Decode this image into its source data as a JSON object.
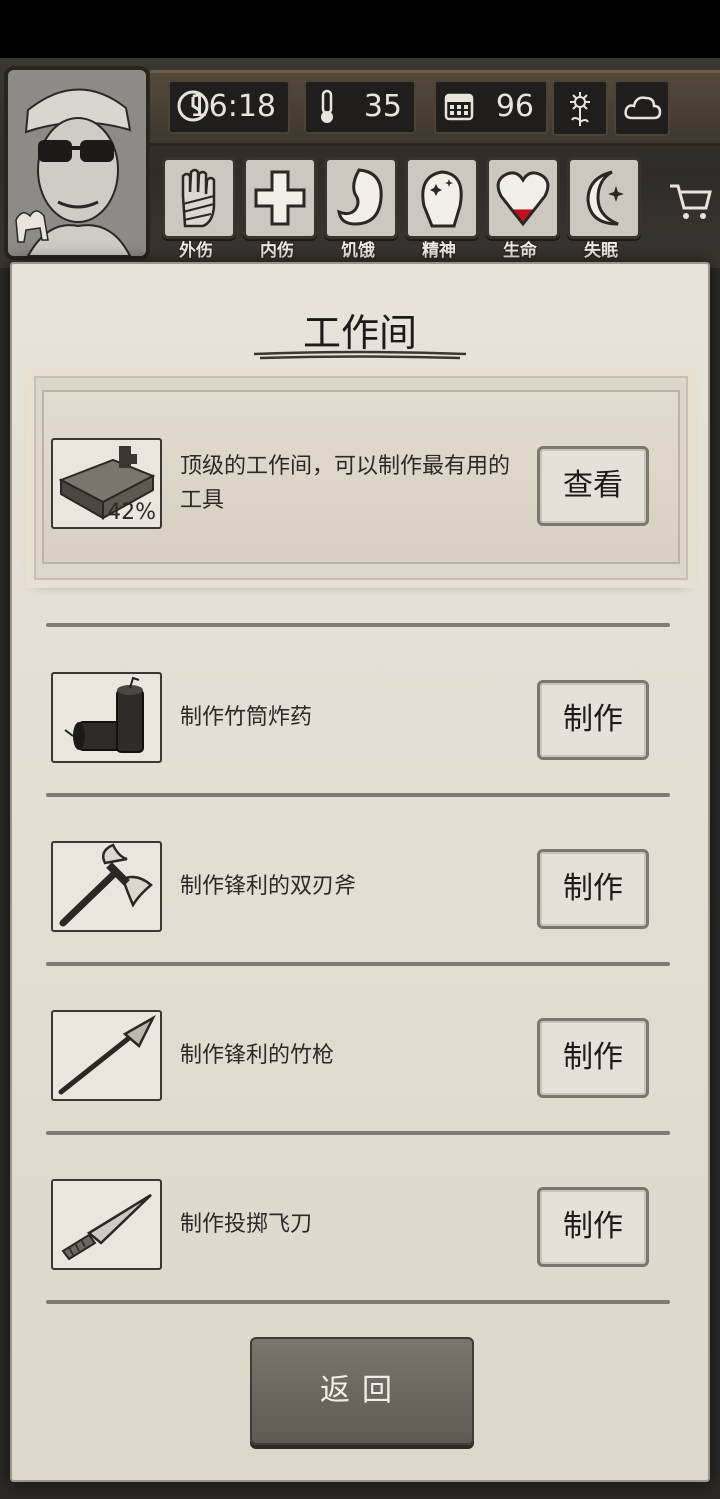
{
  "hud": {
    "time": "16:18",
    "temperature": "35",
    "days": "96",
    "icons": {
      "clock": "clock-icon",
      "thermometer": "thermometer-icon",
      "calendar": "calendar-icon",
      "sun": "sunflower-icon",
      "weather": "cloud-icon"
    }
  },
  "status": [
    {
      "label": "外伤",
      "icon": "bandaged-hand-icon"
    },
    {
      "label": "内伤",
      "icon": "cross-icon"
    },
    {
      "label": "饥饿",
      "icon": "stomach-icon"
    },
    {
      "label": "精神",
      "icon": "head-sparkle-icon"
    },
    {
      "label": "生命",
      "icon": "heart-icon",
      "fill": 0.28,
      "fill_color": "#c0121b"
    },
    {
      "label": "失眠",
      "icon": "moon-star-icon"
    }
  ],
  "page": {
    "title": "工作间"
  },
  "featured": {
    "text": "顶级的工作间，可以制作最有用的工具",
    "progress": "42%",
    "button": "查看",
    "icon": "workbench-icon"
  },
  "recipes": [
    {
      "label": "制作竹筒炸药",
      "button": "制作",
      "icon": "bamboo-dynamite-icon"
    },
    {
      "label": "制作锋利的双刃斧",
      "button": "制作",
      "icon": "double-axe-icon"
    },
    {
      "label": "制作锋利的竹枪",
      "button": "制作",
      "icon": "bamboo-spear-icon"
    },
    {
      "label": "制作投掷飞刀",
      "button": "制作",
      "icon": "throwing-knife-icon"
    }
  ],
  "back_button": "返回"
}
